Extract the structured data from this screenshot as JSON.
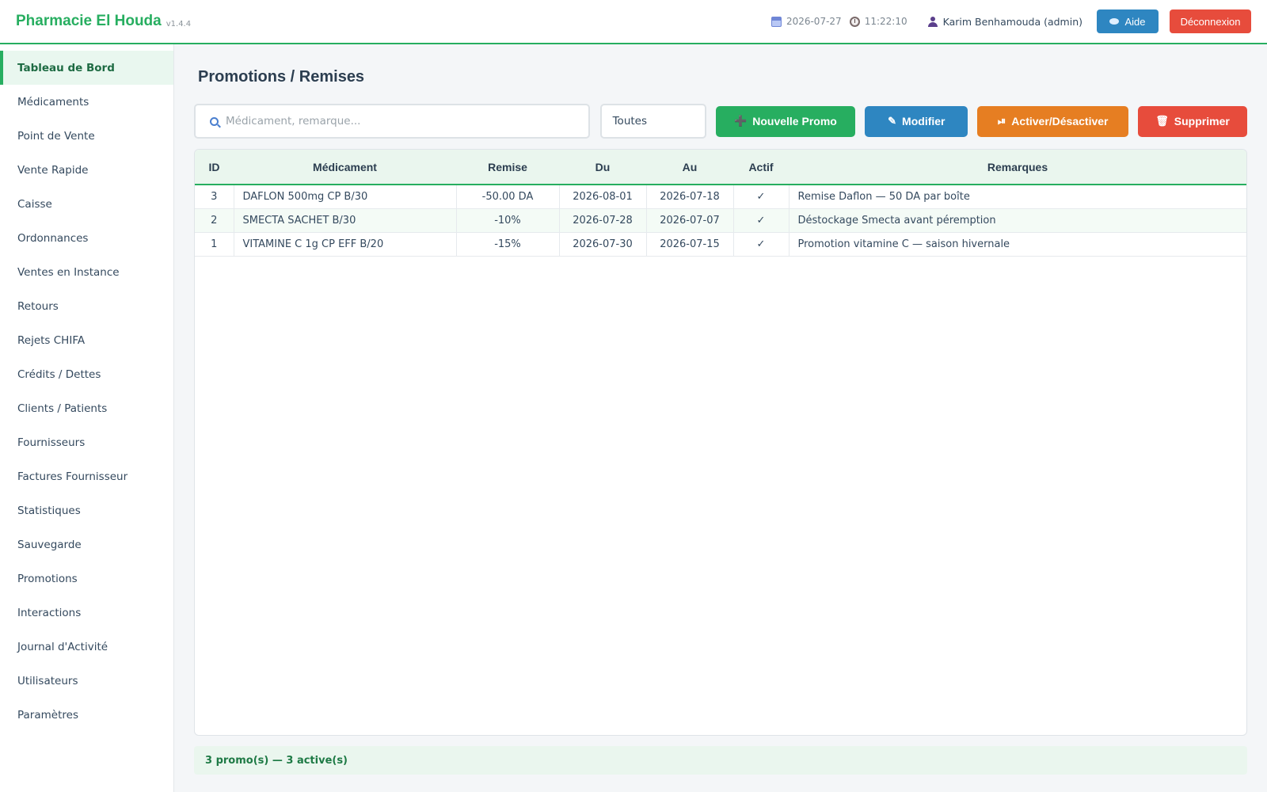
{
  "app": {
    "brand": "Pharmacie El Houda",
    "version": "v1.4.4",
    "date": "2026-07-27",
    "time": "11:22:10",
    "user": "Karim Benhamouda (admin)",
    "help_label": "Aide",
    "logout_label": "Déconnexion"
  },
  "sidebar": {
    "items": [
      {
        "label": "Tableau de Bord"
      },
      {
        "label": "Médicaments"
      },
      {
        "label": "Point de Vente"
      },
      {
        "label": "Vente Rapide"
      },
      {
        "label": "Caisse"
      },
      {
        "label": "Ordonnances"
      },
      {
        "label": "Ventes en Instance"
      },
      {
        "label": "Retours"
      },
      {
        "label": "Rejets CHIFA"
      },
      {
        "label": "Crédits / Dettes"
      },
      {
        "label": "Clients / Patients"
      },
      {
        "label": "Fournisseurs"
      },
      {
        "label": "Factures Fournisseur"
      },
      {
        "label": "Statistiques"
      },
      {
        "label": "Sauvegarde"
      },
      {
        "label": "Promotions"
      },
      {
        "label": "Interactions"
      },
      {
        "label": "Journal d'Activité"
      },
      {
        "label": "Utilisateurs"
      },
      {
        "label": "Paramètres"
      }
    ]
  },
  "page": {
    "title": "Promotions / Remises"
  },
  "toolbar": {
    "search_placeholder": "Médicament, remarque...",
    "filter_value": "Toutes",
    "new_label": "Nouvelle Promo",
    "edit_label": "Modifier",
    "toggle_label": "Activer/Désactiver",
    "delete_label": "Supprimer"
  },
  "table": {
    "headers": [
      "ID",
      "Médicament",
      "Remise",
      "Du",
      "Au",
      "Actif",
      "Remarques"
    ],
    "rows": [
      {
        "id": "3",
        "med": "DAFLON 500mg CP B/30",
        "remise": "-50.00 DA",
        "du": "2026-08-01",
        "au": "2026-07-18",
        "actif": "✓",
        "remarques": "Remise Daflon — 50 DA par boîte"
      },
      {
        "id": "2",
        "med": "SMECTA SACHET B/30",
        "remise": "-10%",
        "du": "2026-07-28",
        "au": "2026-07-07",
        "actif": "✓",
        "remarques": "Déstockage Smecta avant péremption"
      },
      {
        "id": "1",
        "med": "VITAMINE C 1g CP EFF B/20",
        "remise": "-15%",
        "du": "2026-07-30",
        "au": "2026-07-15",
        "actif": "✓",
        "remarques": "Promotion vitamine C — saison hivernale"
      }
    ]
  },
  "status": {
    "text": "3 promo(s) — 3 active(s)"
  },
  "colors": {
    "brand": "#27ae60",
    "help": "#2e86c1",
    "logout": "#e74c3c",
    "toggle": "#e67e22"
  }
}
